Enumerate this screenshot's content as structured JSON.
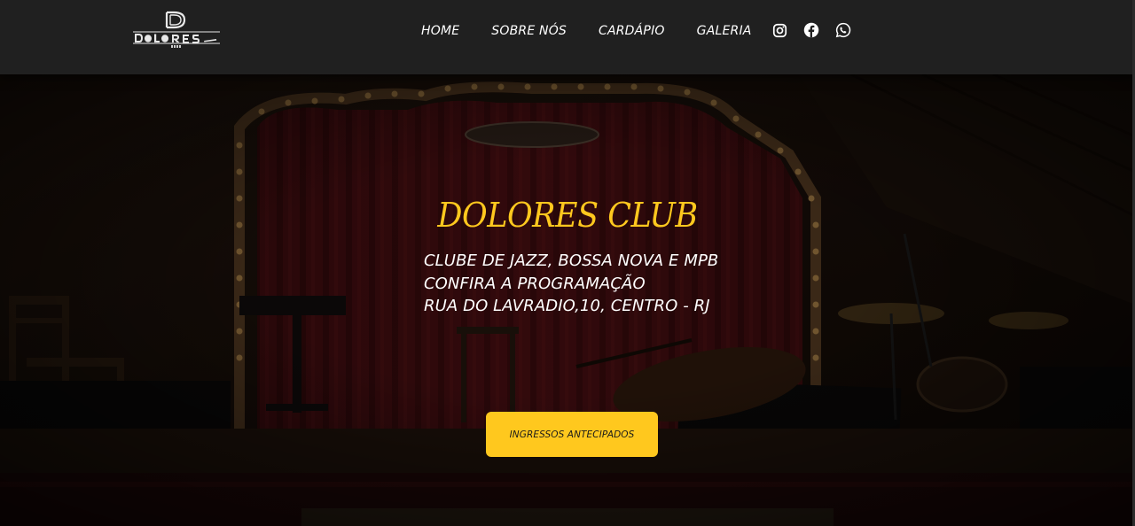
{
  "brand": {
    "logo_icon": "dolores-club-logo",
    "colors": {
      "header_bg": "#202020",
      "accent": "#ffc81e",
      "text": "#ffffff"
    }
  },
  "nav": {
    "items": [
      {
        "label": "HOME"
      },
      {
        "label": "SOBRE NÓS"
      },
      {
        "label": "CARDÁPIO"
      },
      {
        "label": "GALERIA"
      }
    ],
    "socials": [
      {
        "icon": "instagram-icon"
      },
      {
        "icon": "facebook-icon"
      },
      {
        "icon": "whatsapp-icon"
      }
    ]
  },
  "hero": {
    "title": "DOLORES CLUB",
    "lines": [
      "CLUBE DE JAZZ, BOSSA NOVA E MPB",
      "CONFIRA A PROGRAMAÇÃO",
      "RUA DO LAVRADIO,10, CENTRO - RJ"
    ],
    "cta_label": "INGRESSOS ANTECIPADOS",
    "background": "stage-photo"
  }
}
